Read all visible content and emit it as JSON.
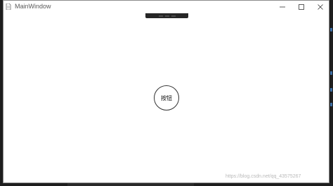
{
  "window": {
    "title": "MainWindow"
  },
  "titlebar_controls": {
    "minimize_icon": "minimize-icon",
    "maximize_icon": "maximize-icon",
    "close_icon": "close-icon"
  },
  "content": {
    "button_label": "按钮"
  },
  "watermark": {
    "text": "https://blog.csdn.net/qq_43575267"
  }
}
